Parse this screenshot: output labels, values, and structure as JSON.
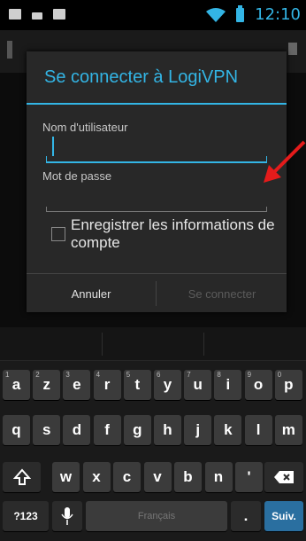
{
  "status_bar": {
    "time": "12:10"
  },
  "dialog": {
    "title": "Se connecter à LogiVPN",
    "username_label": "Nom d'utilisateur",
    "username_value": "",
    "password_label": "Mot de passe",
    "password_value": "",
    "remember_label": "Enregistrer les informations de compte",
    "remember_checked": false,
    "cancel_label": "Annuler",
    "connect_label": "Se connecter"
  },
  "keyboard": {
    "row1": [
      {
        "key": "a",
        "hint": "1"
      },
      {
        "key": "z",
        "hint": "2"
      },
      {
        "key": "e",
        "hint": "3"
      },
      {
        "key": "r",
        "hint": "4"
      },
      {
        "key": "t",
        "hint": "5"
      },
      {
        "key": "y",
        "hint": "6"
      },
      {
        "key": "u",
        "hint": "7"
      },
      {
        "key": "i",
        "hint": "8"
      },
      {
        "key": "o",
        "hint": "9"
      },
      {
        "key": "p",
        "hint": "0"
      }
    ],
    "row2": [
      "q",
      "s",
      "d",
      "f",
      "g",
      "h",
      "j",
      "k",
      "l",
      "m"
    ],
    "row3": [
      "w",
      "x",
      "c",
      "v",
      "b",
      "n",
      "'"
    ],
    "symbols_label": "?123",
    "space_label": "Français",
    "period_label": ".",
    "next_label": "Suiv."
  },
  "colors": {
    "accent": "#33b5e5",
    "arrow": "#e41b1b"
  }
}
